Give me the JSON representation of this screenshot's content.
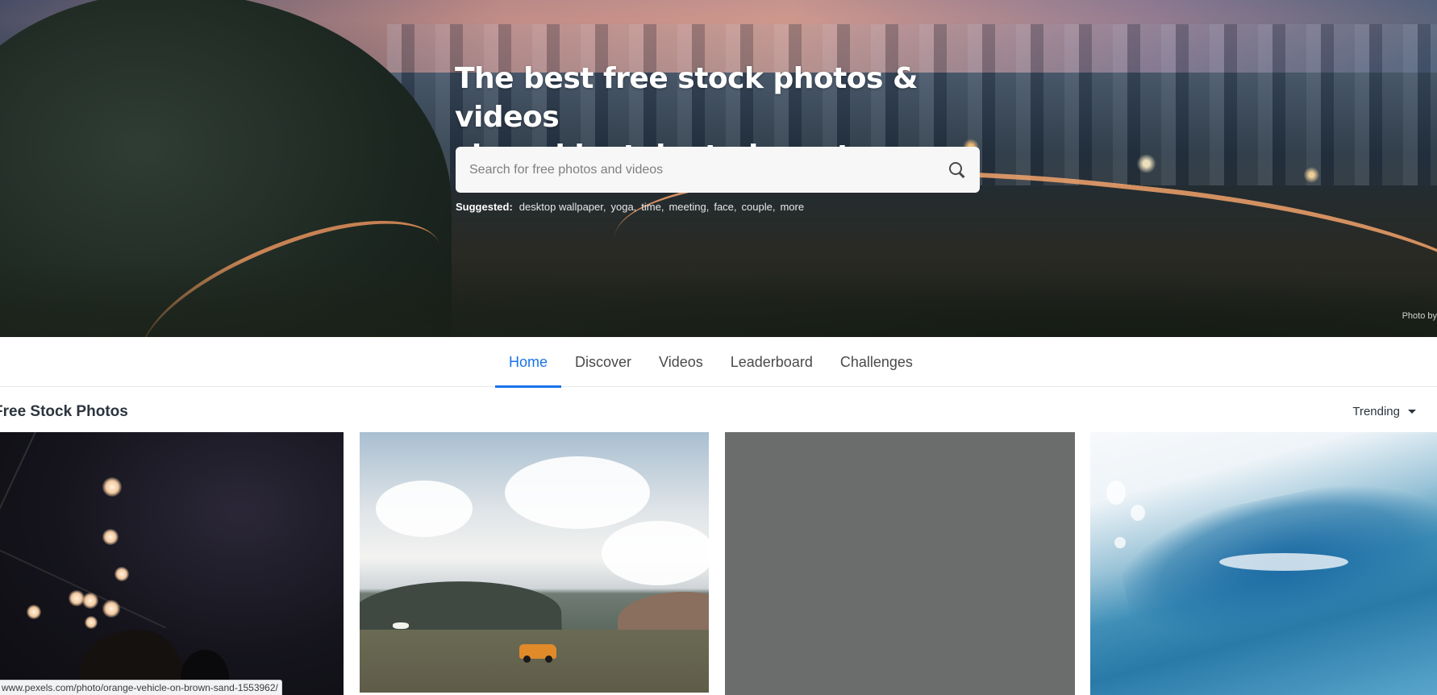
{
  "hero": {
    "title_line1": "The best free stock photos & videos",
    "title_line2": "shared by talented creators.",
    "photo_credit": "Photo by",
    "search": {
      "placeholder": "Search for free photos and videos",
      "icon": "search-icon"
    },
    "suggested": {
      "label": "Suggested:",
      "items": [
        "desktop wallpaper,",
        "yoga,",
        "time,",
        "meeting,",
        "face,",
        "couple,",
        "more"
      ]
    }
  },
  "nav": {
    "tabs": [
      {
        "label": "Home",
        "active": true
      },
      {
        "label": "Discover",
        "active": false
      },
      {
        "label": "Videos",
        "active": false
      },
      {
        "label": "Leaderboard",
        "active": false
      },
      {
        "label": "Challenges",
        "active": false
      }
    ],
    "accent_color": "#1a73e8"
  },
  "section": {
    "title": "Free Stock Photos",
    "sort": {
      "selected": "Trending",
      "icon": "caret-down-icon"
    }
  },
  "status_bar": {
    "url": "www.pexels.com/photo/orange-vehicle-on-brown-sand-1553962/"
  }
}
